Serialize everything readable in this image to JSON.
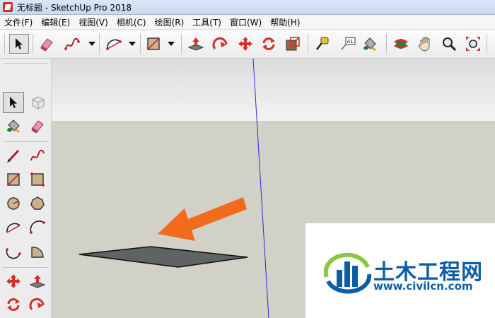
{
  "window": {
    "title": "无标题 - SketchUp Pro 2018"
  },
  "menubar": {
    "items": [
      "文件(F)",
      "编辑(E)",
      "视图(V)",
      "相机(C)",
      "绘图(R)",
      "工具(T)",
      "窗口(W)",
      "帮助(H)"
    ]
  },
  "toolbar": {
    "tools": [
      {
        "name": "select-tool",
        "icon": "arrow-cursor-icon"
      },
      {
        "name": "eraser-tool",
        "icon": "eraser-icon"
      },
      {
        "name": "freehand-tool",
        "icon": "freehand-icon"
      },
      {
        "name": "arc-tool",
        "icon": "arc-icon"
      },
      {
        "name": "rectangle-tool",
        "icon": "rectangle-icon"
      },
      {
        "name": "push-pull-tool",
        "icon": "push-pull-icon"
      },
      {
        "name": "follow-me-tool",
        "icon": "follow-me-icon"
      },
      {
        "name": "move-tool",
        "icon": "move-icon"
      },
      {
        "name": "rotate-tool",
        "icon": "rotate-icon"
      },
      {
        "name": "scale-tool",
        "icon": "scale-icon"
      },
      {
        "name": "tape-measure-tool",
        "icon": "tape-measure-icon"
      },
      {
        "name": "text-tool",
        "icon": "text-icon"
      },
      {
        "name": "paint-bucket-tool",
        "icon": "paint-bucket-icon"
      },
      {
        "name": "orbit-tool",
        "icon": "orbit-icon"
      },
      {
        "name": "pan-tool",
        "icon": "hand-icon"
      },
      {
        "name": "zoom-tool",
        "icon": "magnifier-icon"
      },
      {
        "name": "zoom-extents-tool",
        "icon": "zoom-extents-icon"
      }
    ],
    "text_tool_label": "A1"
  },
  "watermark": {
    "title": "土木工程网",
    "url": "www.civilcn.com",
    "colors": {
      "blue": "#0c5da8",
      "green": "#8cc63f"
    }
  },
  "colors": {
    "sky_top": "#dcdcdc",
    "ground": "#d1d1c7",
    "face": "#5f6364",
    "arrow": "#f26a1b",
    "axis_blue": "#2a2ad0"
  }
}
